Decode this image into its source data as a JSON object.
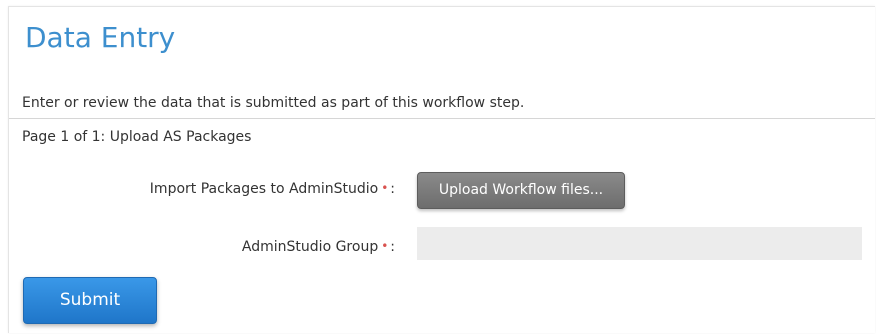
{
  "header": {
    "title": "Data Entry"
  },
  "description": "Enter or review the data that is submitted as part of this workflow step.",
  "page_indicator": "Page 1 of 1: Upload AS Packages",
  "fields": {
    "import_packages": {
      "label": "Import Packages to AdminStudio",
      "required_marker": "•",
      "suffix": ":",
      "button_label": "Upload Workflow files..."
    },
    "adminstudio_group": {
      "label": "AdminStudio Group",
      "required_marker": "•",
      "suffix": ":",
      "value": ""
    }
  },
  "actions": {
    "submit_label": "Submit"
  },
  "colors": {
    "title": "#3d8fce",
    "required": "#d9534f",
    "submit_button": "#2a86d8",
    "upload_button": "#7a7a7a",
    "input_background": "#ececec"
  }
}
